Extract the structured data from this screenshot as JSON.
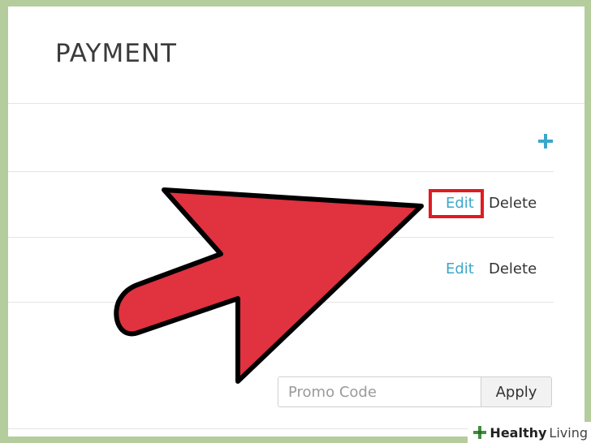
{
  "page": {
    "title": "PAYMENT"
  },
  "actions": {
    "add_icon": "plus-icon",
    "accent_color": "#3ba7c9"
  },
  "payment_methods": [
    {
      "edit_label": "Edit",
      "delete_label": "Delete",
      "highlighted": true
    },
    {
      "edit_label": "Edit",
      "delete_label": "Delete",
      "highlighted": false
    }
  ],
  "promo": {
    "placeholder": "Promo Code",
    "value": "",
    "apply_label": "Apply"
  },
  "overlay": {
    "arrow_color": "#e0323f",
    "highlight_color": "#e01b22"
  },
  "watermark": {
    "brand_strong": "Healthy",
    "brand_light": "Living"
  }
}
